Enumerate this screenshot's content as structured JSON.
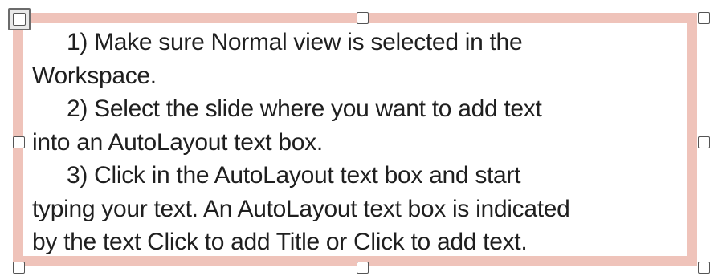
{
  "textbox": {
    "paragraphs": [
      {
        "first": "1) Make sure Normal view is selected in the",
        "rest": [
          "Workspace."
        ]
      },
      {
        "first": "2) Select the slide where you want to add text",
        "rest": [
          "into an AutoLayout text box."
        ]
      },
      {
        "first": "3) Click in the AutoLayout text box and start",
        "rest": [
          "typing your text. An AutoLayout text box is indicated",
          "by the text Click to add Title or Click to add text."
        ]
      }
    ]
  },
  "colors": {
    "frame_border": "#efc3ba",
    "text": "#1f1f1f",
    "handle_border": "#555555"
  }
}
